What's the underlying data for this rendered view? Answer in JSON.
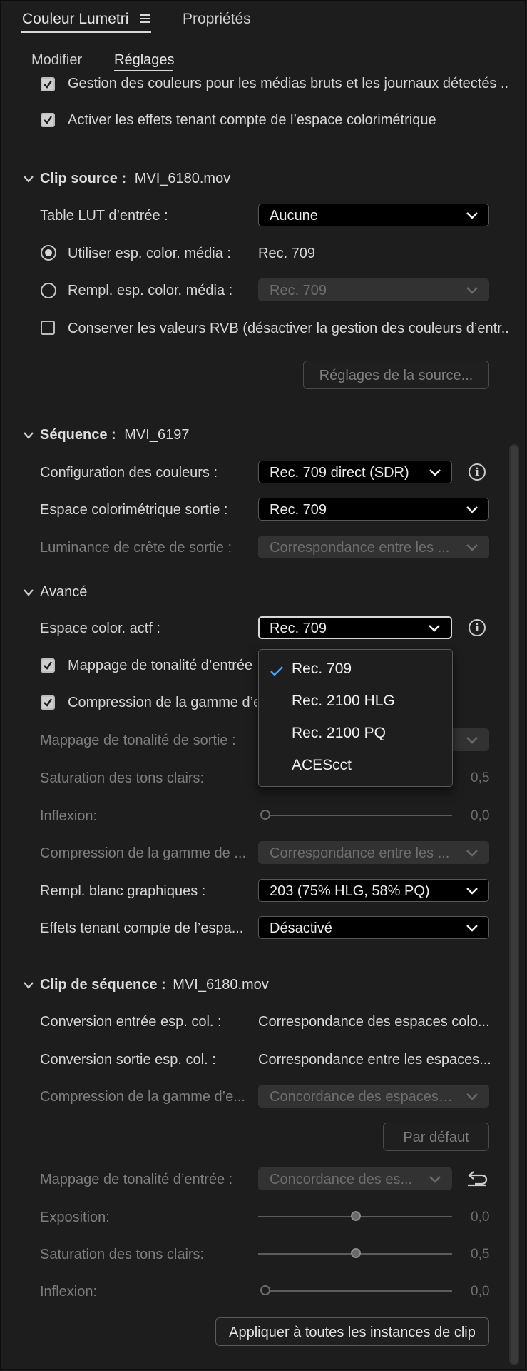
{
  "panel_tabs": {
    "active": "Couleur Lumetri",
    "menu_icon": "hamburger-menu-icon",
    "other": "Propriétés"
  },
  "subtabs": {
    "modify": "Modifier",
    "settings": "Réglages"
  },
  "top_checks": {
    "media_color_management": "Gestion des couleurs pour les médias bruts et les journaux détectés ...",
    "color_aware_effects": "Activer les effets tenant compte de l’espace colorimétrique"
  },
  "clip_source": {
    "header_bold": "Clip source :",
    "header_value": "MVI_6180.mov",
    "lut_label": "Table LUT d’entrée :",
    "lut_value": "Aucune",
    "use_media_label": "Utiliser esp. color. média :",
    "use_media_value": "Rec. 709",
    "override_label": "Rempl. esp. color. média :",
    "override_value": "Rec. 709",
    "preserve_rgb": "Conserver les valeurs RVB (désactiver la gestion des couleurs d’entr...",
    "source_settings_button": "Réglages de la source..."
  },
  "sequence": {
    "header_bold": "Séquence :",
    "header_value": "MVI_6197",
    "color_config_label": "Configuration des couleurs :",
    "color_config_value": "Rec. 709 direct (SDR)",
    "output_space_label": "Espace colorimétrique sortie :",
    "output_space_value": "Rec. 709",
    "peak_luminance_label": "Luminance de crête de sortie :",
    "peak_luminance_value": "Correspondance entre les ..."
  },
  "advanced": {
    "header": "Avancé",
    "working_space_label": "Espace color. actf :",
    "working_space_value": "Rec. 709",
    "input_tone_mapping": "Mappage de tonalité d’entrée",
    "gamut_compression": "Compression de la gamme d’e",
    "output_tone_mapping_label": "Mappage de tonalité de sortie :",
    "highlight_saturation_label": "Saturation des tons clairs:",
    "highlight_saturation_value": "0,5",
    "knee_label": "Inflexion:",
    "knee_value": "0,0",
    "gamut_compression2_label": "Compression de la gamme de ...",
    "gamut_compression2_value": "Correspondance entre les ...",
    "graphics_white_label": "Rempl. blanc graphiques :",
    "graphics_white_value": "203 (75% HLG, 58% PQ)",
    "color_aware_label": "Effets tenant compte de l’espa...",
    "color_aware_value": "Désactivé"
  },
  "dropdown_menu": {
    "items": [
      "Rec. 709",
      "Rec. 2100 HLG",
      "Rec. 2100 PQ",
      "ACEScct"
    ],
    "selected": "Rec. 709",
    "check_color": "#4a9ff5"
  },
  "sequence_clip": {
    "header_bold": "Clip de séquence :",
    "header_value": "MVI_6180.mov",
    "input_conversion_label": "Conversion entrée esp. col. :",
    "input_conversion_value": "Correspondance des espaces colo...",
    "output_conversion_label": "Conversion sortie esp. col. :",
    "output_conversion_value": "Correspondance entre les espaces...",
    "gamut_label": "Compression de la gamme d’e...",
    "gamut_value": "Concordance des espaces ...",
    "default_button": "Par défaut",
    "input_tone_label": "Mappage de tonalité d’entrée :",
    "input_tone_value": "Concordance des es...",
    "exposure_label": "Exposition:",
    "exposure_value": "0,0",
    "highlight_sat_label": "Saturation des tons clairs:",
    "highlight_sat_value": "0,5",
    "knee_label": "Inflexion:",
    "knee_value": "0,0",
    "apply_all_button": "Appliquer à toutes les instances de clip"
  }
}
